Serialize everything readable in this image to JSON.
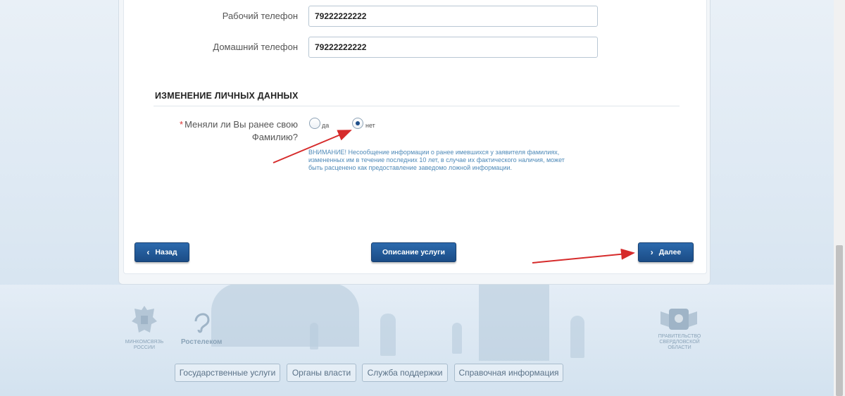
{
  "form": {
    "work_phone": {
      "label": "Рабочий телефон",
      "value": "79222222222"
    },
    "home_phone": {
      "label": "Домашний телефон",
      "value": "79222222222"
    },
    "section_title": "ИЗМЕНЕНИЕ ЛИЧНЫХ ДАННЫХ",
    "question": {
      "required_mark": "*",
      "text_line1": "Меняли ли Вы ранее свою",
      "text_line2": "Фамилию?",
      "options": [
        {
          "label": "да",
          "checked": false
        },
        {
          "label": "нет",
          "checked": true
        }
      ]
    },
    "warning": "ВНИМАНИЕ! Несообщение информации о ранее имевшихся у заявителя фамилиях, измененных им в течение последних 10 лет, в случае их фактического наличия, может быть расценено как предоставление заведомо ложной информации."
  },
  "buttons": {
    "back": {
      "icon": "‹",
      "label": "Назад"
    },
    "description": {
      "label": "Описание услуги"
    },
    "next": {
      "icon": "›",
      "label": "Далее"
    }
  },
  "footer": {
    "logo_left_text": "МИНКОМСВЯЗЬ РОССИИ",
    "logo_rostelecom": "Ростелеком",
    "logo_right_text": "ПРАВИТЕЛЬСТВО СВЕРДЛОВСКОЙ ОБЛАСТИ",
    "links": [
      "Государственные услуги",
      "Органы власти",
      "Служба поддержки",
      "Справочная информация"
    ]
  },
  "colors": {
    "accent": "#1e4f8a",
    "annotation_arrow": "#d62b2b",
    "warning_text": "#4f8ab8"
  }
}
